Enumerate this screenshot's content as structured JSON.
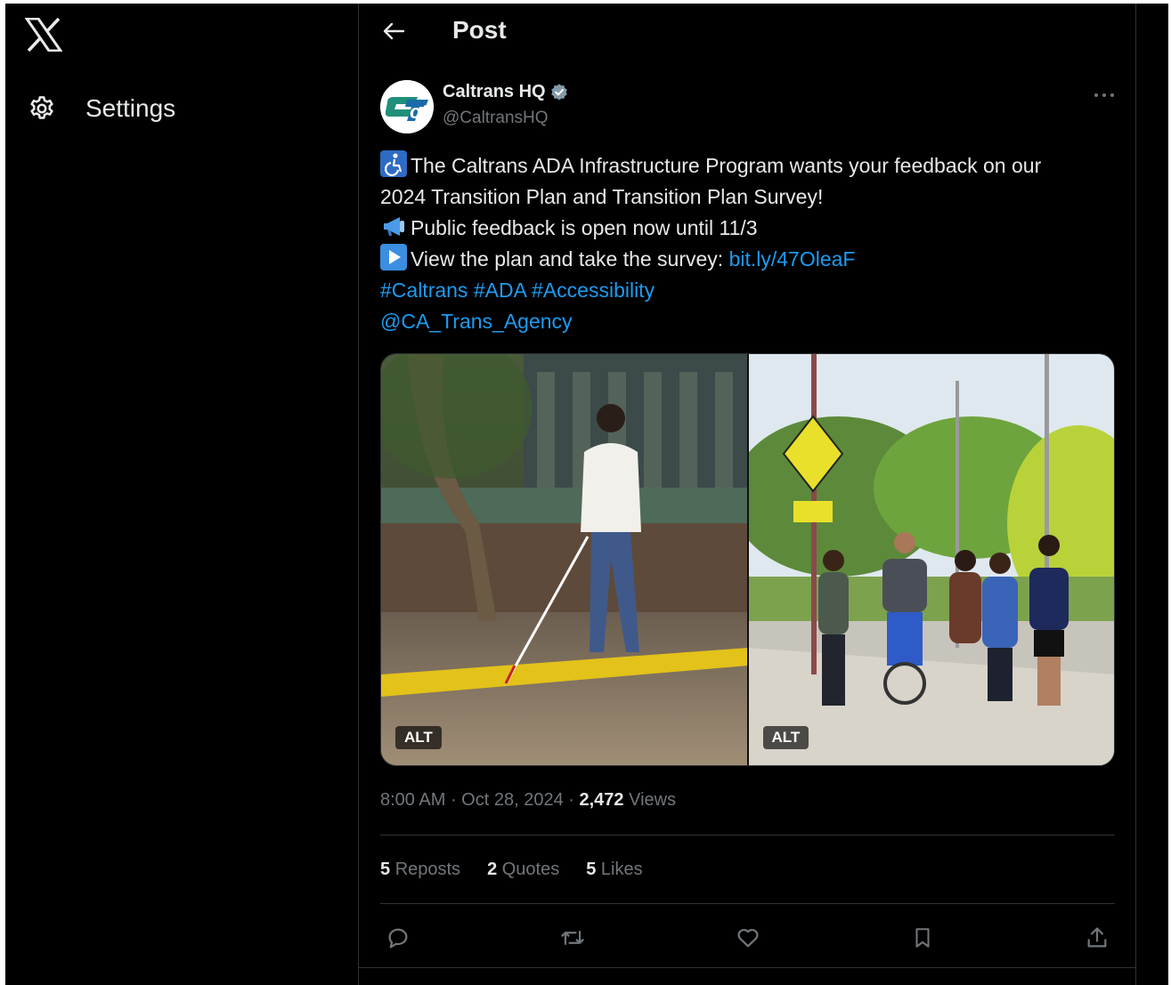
{
  "nav": {
    "logo_icon": "x-logo-icon",
    "settings_label": "Settings",
    "settings_icon": "gear-icon"
  },
  "header": {
    "title": "Post",
    "back_icon": "arrow-left-icon"
  },
  "post": {
    "author": {
      "display_name": "Caltrans HQ",
      "handle": "@CaltransHQ",
      "verified": true,
      "avatar_logo": "ct"
    },
    "lines": [
      {
        "emoji": "wheelchair-icon",
        "text": "The Caltrans ADA Infrastructure Program wants your feedback on our"
      },
      {
        "text": "2024 Transition Plan and Transition Plan Survey!"
      },
      {
        "emoji": "megaphone-icon",
        "text": "Public feedback is open now until 11/3"
      },
      {
        "emoji": "play-button-icon",
        "text": "View the plan and take the survey: ",
        "link": "bit.ly/47OleaF"
      }
    ],
    "hashtags": "#Caltrans #ADA #Accessibility",
    "mention": "@CA_Trans_Agency",
    "media": [
      {
        "alt_label": "ALT"
      },
      {
        "alt_label": "ALT"
      }
    ],
    "time": "8:00 AM",
    "date": "Oct 28, 2024",
    "views_count": "2,472",
    "views_label": "Views",
    "stats": {
      "reposts_count": "5",
      "reposts_label": "Reposts",
      "quotes_count": "2",
      "quotes_label": "Quotes",
      "likes_count": "5",
      "likes_label": "Likes"
    }
  },
  "colors": {
    "background": "#000000",
    "text": "#e7e9ea",
    "muted": "#71767b",
    "link": "#1d9bf0",
    "border": "#2f3336"
  }
}
